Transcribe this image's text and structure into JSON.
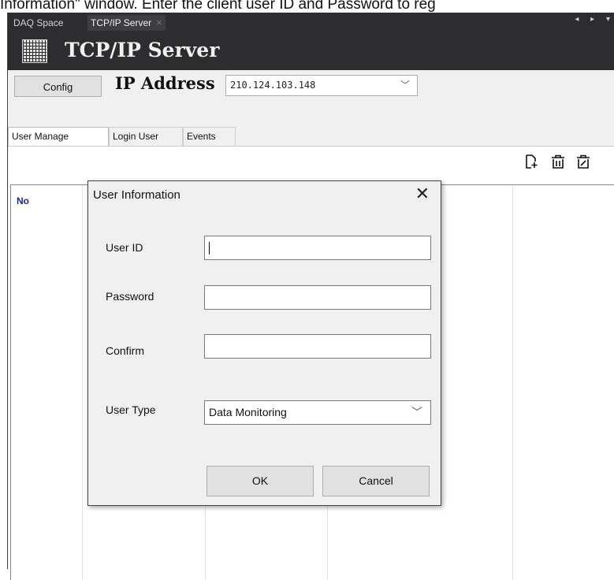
{
  "caption": "Information\" window. Enter the client user ID and Password to reg",
  "doc_tabs": [
    {
      "label": "DAQ Space"
    },
    {
      "label": "TCP/IP Server",
      "close": "×"
    }
  ],
  "nav": {
    "arrows": "◂ ▸ ▾"
  },
  "window": {
    "title": "TCP/IP Server"
  },
  "toolbar": {
    "config_label": "Config",
    "ip_label": "IP Address",
    "ip_value": "210.124.103.148"
  },
  "tabs": [
    {
      "label": "User Manage",
      "active": true
    },
    {
      "label": "Login User"
    },
    {
      "label": "Events"
    }
  ],
  "actions": {
    "icons": [
      "add-user-icon",
      "delete-user-icon",
      "edit-user-icon"
    ]
  },
  "table": {
    "columns": [
      "No",
      "",
      "",
      "",
      ""
    ]
  },
  "dialog": {
    "title": "User Information",
    "close": "✕",
    "fields": [
      {
        "label": "User ID",
        "value": ""
      },
      {
        "label": "Password",
        "value": ""
      },
      {
        "label": "Confirm",
        "value": ""
      }
    ],
    "user_type_label": "User Type",
    "user_type_value": "Data Monitoring",
    "ok_label": "OK",
    "cancel_label": "Cancel"
  },
  "colors": {
    "app_dark": "#2d2d30",
    "header_text": "#f0f0f0",
    "no_column": "#1a2b8c"
  }
}
